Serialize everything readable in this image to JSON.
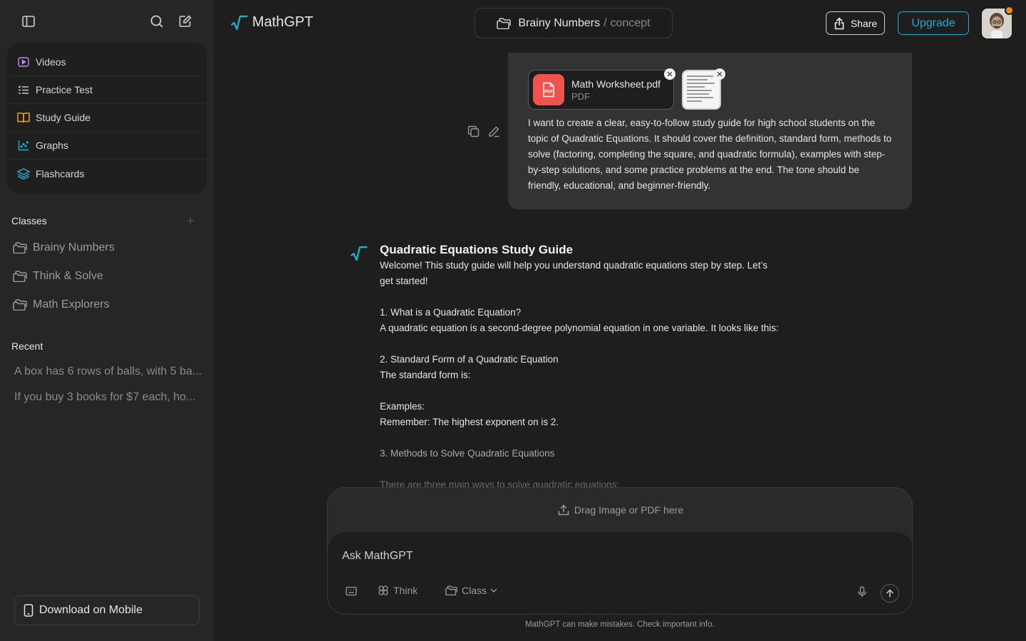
{
  "brand": {
    "name": "MathGPT",
    "accent": "#2aa8c8"
  },
  "sidebar": {
    "tools": [
      {
        "label": "Videos",
        "icon": "video-icon",
        "color": "#b58cf5"
      },
      {
        "label": "Practice Test",
        "icon": "list-icon",
        "color": "#cfcfcf"
      },
      {
        "label": "Study Guide",
        "icon": "book-icon",
        "color": "#f0a020"
      },
      {
        "label": "Graphs",
        "icon": "graph-icon",
        "color": "#2aa8c8"
      },
      {
        "label": "Flashcards",
        "icon": "layers-icon",
        "color": "#2aa8c8"
      }
    ],
    "classes_title": "Classes",
    "classes": [
      "Brainy Numbers",
      "Think & Solve",
      "Math Explorers"
    ],
    "recent_title": "Recent",
    "recent": [
      "A box has 6 rows of balls, with 5 ba...",
      "If you buy 3 books for $7 each, ho..."
    ],
    "download_label": "Download on Mobile"
  },
  "header": {
    "breadcrumb_class": "Brainy Numbers",
    "breadcrumb_sep": "/",
    "breadcrumb_page": "concept",
    "share_label": "Share",
    "upgrade_label": "Upgrade"
  },
  "user_message": {
    "file_name": "Math Worksheet.pdf",
    "file_type": "PDF",
    "text": "I want to create a clear, easy-to-follow study guide for high school students on the topic of Quadratic Equations. It should cover the definition, standard form, methods to solve (factoring, completing the square, and quadratic formula), examples with step-by-step solutions, and some practice problems at the end. The tone should be friendly, educational, and beginner-friendly."
  },
  "assistant": {
    "title": "Quadratic Equations Study Guide",
    "intro": "Welcome! This study guide will help you understand quadratic equations step by step. Let’s get started!",
    "s1_heading": "1. What is a Quadratic Equation?",
    "s1_body": "A quadratic equation is a second-degree polynomial equation in one variable. It looks like this:",
    "s2_heading": "2. Standard Form of a Quadratic Equation",
    "s2_body": "The standard form is:",
    "examples": "Examples:",
    "remember": "Remember: The highest exponent on  is 2.",
    "s3_heading": "3. Methods to Solve Quadratic Equations",
    "s3_body": "There are three main ways to solve quadratic equations:"
  },
  "composer": {
    "drop_label": "Drag Image  or PDF here",
    "placeholder": "Ask MathGPT",
    "think_label": "Think",
    "class_label": "Class",
    "disclaimer": "MathGPT can make mistakes. Check important info."
  }
}
